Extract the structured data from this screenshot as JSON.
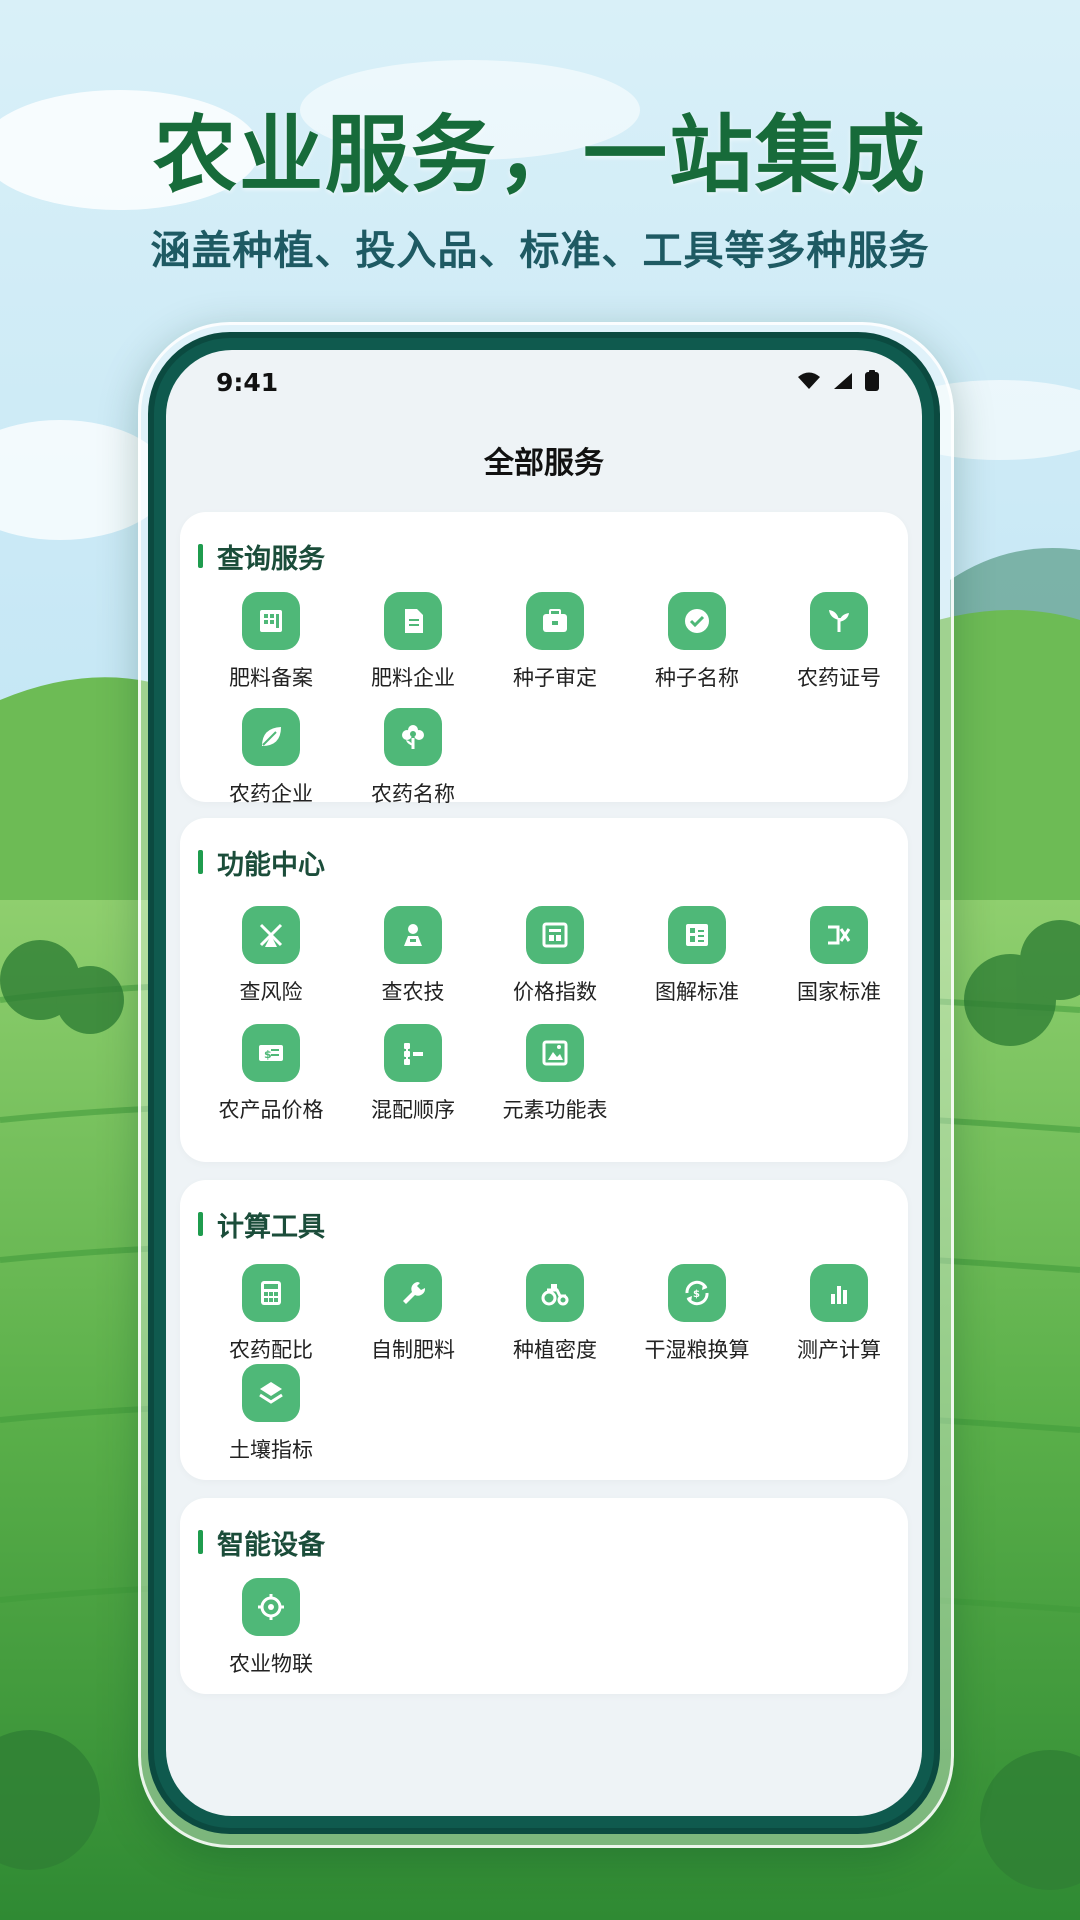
{
  "hero": {
    "title": "农业服务，一站集成",
    "subtitle": "涵盖种植、投入品、标准、工具等多种服务"
  },
  "status": {
    "time": "9:41"
  },
  "page_title": "全部服务",
  "sections": [
    {
      "title": "查询服务",
      "items": [
        {
          "label": "肥料备案",
          "icon": "building-icon"
        },
        {
          "label": "肥料企业",
          "icon": "document-icon"
        },
        {
          "label": "种子审定",
          "icon": "briefcase-icon"
        },
        {
          "label": "种子名称",
          "icon": "verified-badge-icon"
        },
        {
          "label": "农药证号",
          "icon": "sprout-icon"
        },
        {
          "label": "农药企业",
          "icon": "leaf-icon"
        },
        {
          "label": "农药名称",
          "icon": "flower-icon"
        }
      ]
    },
    {
      "title": "功能中心",
      "items": [
        {
          "label": "查风险",
          "icon": "risk-icon"
        },
        {
          "label": "查农技",
          "icon": "farm-tech-icon"
        },
        {
          "label": "价格指数",
          "icon": "price-index-icon"
        },
        {
          "label": "图解标准",
          "icon": "illustrated-standard-icon"
        },
        {
          "label": "国家标准",
          "icon": "national-standard-icon"
        },
        {
          "label": "农产品价格",
          "icon": "price-tag-icon"
        },
        {
          "label": "混配顺序",
          "icon": "list-order-icon"
        },
        {
          "label": "元素功能表",
          "icon": "image-table-icon"
        }
      ]
    },
    {
      "title": "计算工具",
      "items": [
        {
          "label": "农药配比",
          "icon": "calculator-icon"
        },
        {
          "label": "自制肥料",
          "icon": "wrench-icon"
        },
        {
          "label": "种植密度",
          "icon": "tractor-icon"
        },
        {
          "label": "干湿粮换算",
          "icon": "exchange-icon"
        },
        {
          "label": "测产计算",
          "icon": "bar-chart-icon"
        },
        {
          "label": "土壤指标",
          "icon": "layers-icon"
        }
      ]
    },
    {
      "title": "智能设备",
      "items": [
        {
          "label": "农业物联",
          "icon": "iot-chip-icon"
        }
      ]
    }
  ]
}
